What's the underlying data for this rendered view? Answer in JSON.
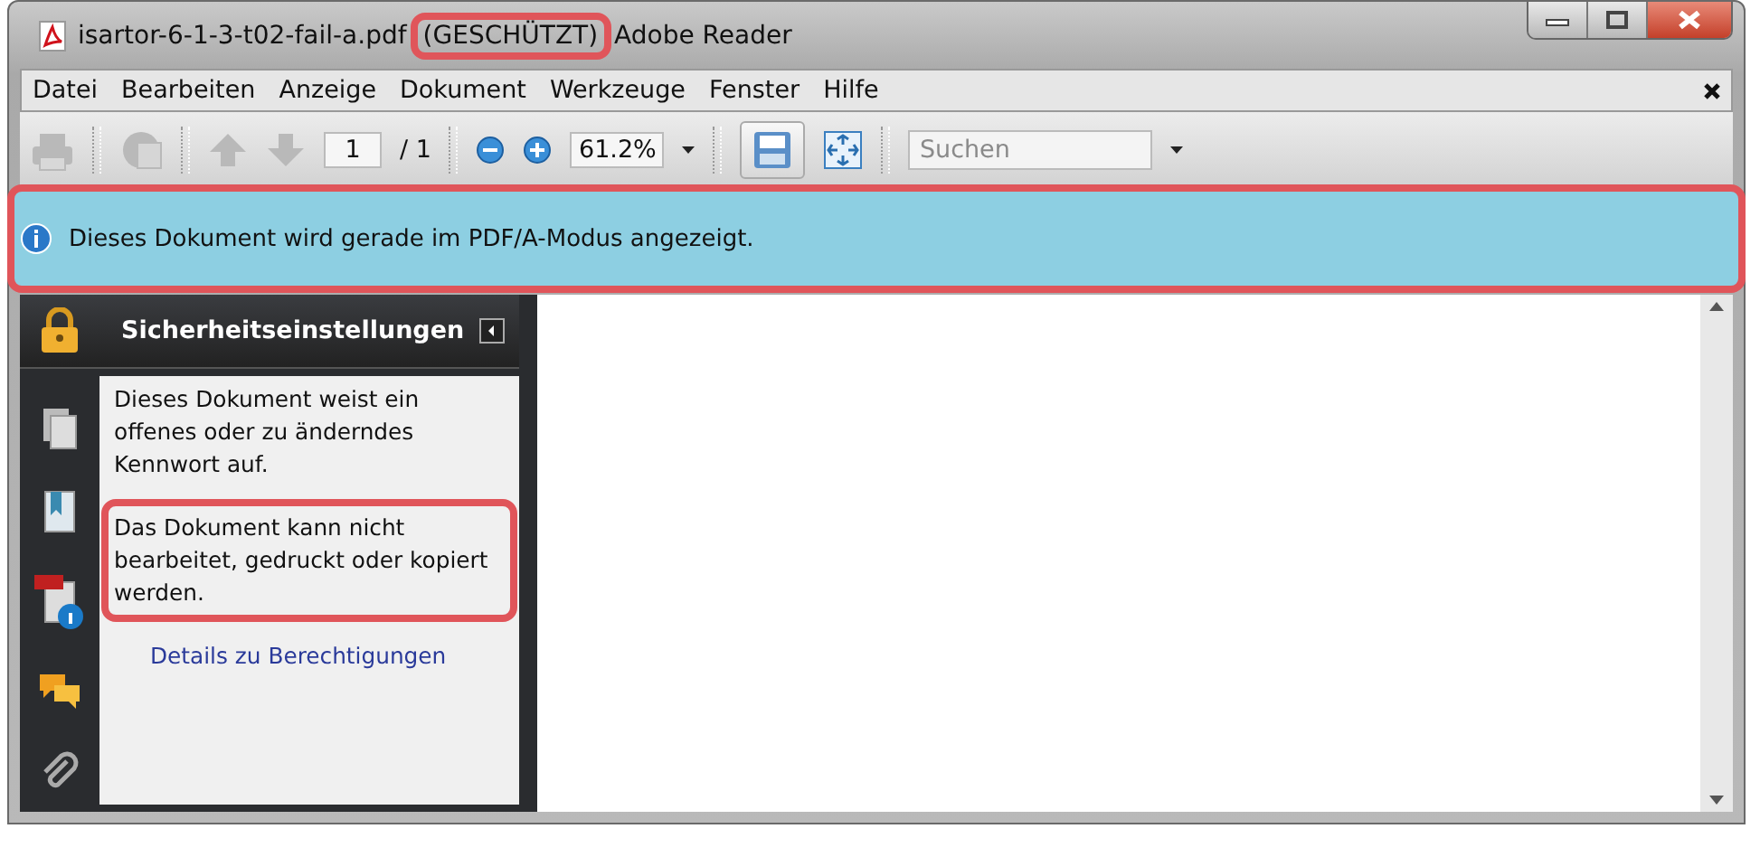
{
  "window": {
    "title_parts": [
      {
        "text": "isartor-6-1-3-t02-fail-a.pdf",
        "highlighted": false
      },
      {
        "text": "(GESCHÜTZT)",
        "highlighted": true
      },
      {
        "text": "Adobe Reader",
        "highlighted": false
      }
    ]
  },
  "menu": [
    "Datei",
    "Bearbeiten",
    "Anzeige",
    "Dokument",
    "Werkzeuge",
    "Fenster",
    "Hilfe"
  ],
  "toolbar": {
    "page": "1",
    "page_total": "/ 1",
    "zoom": "61.2%",
    "search": {
      "placeholder": "Suchen"
    }
  },
  "banner": {
    "text": "Dieses Dokument wird gerade im PDF/A-Modus angezeigt.",
    "highlighted": true
  },
  "side_panel": {
    "title": "Sicherheitseinstellungen",
    "paragraphs": [
      {
        "text": "Dieses Dokument weist ein offenes oder zu änderndes Kennwort auf.",
        "highlighted": false
      },
      {
        "text": "Das Dokument kann nicht bearbeitet, gedruckt oder kopiert werden.",
        "highlighted": true
      }
    ],
    "link": "Details zu Berechtigungen"
  }
}
